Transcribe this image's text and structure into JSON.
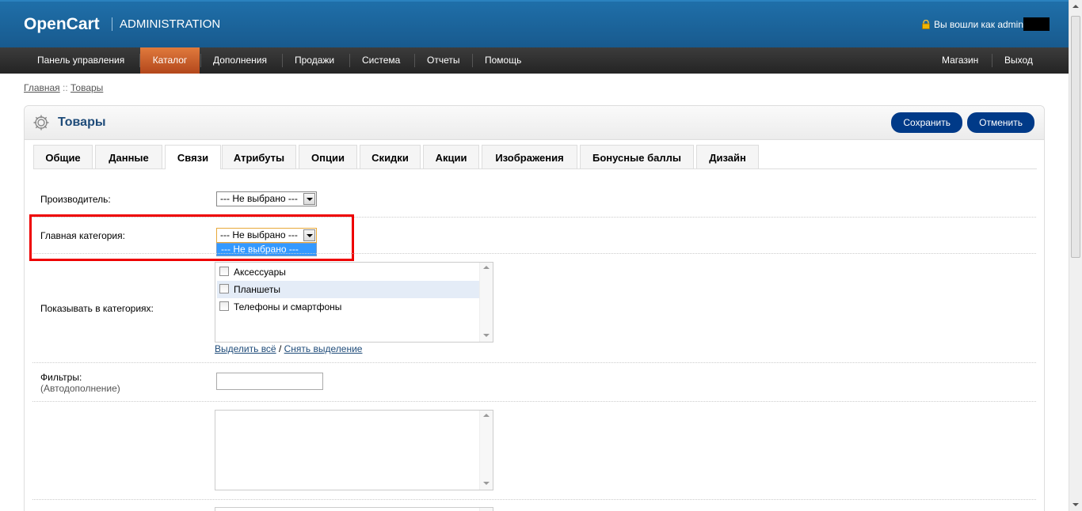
{
  "header": {
    "logo": "OpenCart",
    "subtitle": "ADMINISTRATION",
    "login_text": "Вы вошли как admin"
  },
  "menu": {
    "items": [
      {
        "label": "Панель управления"
      },
      {
        "label": "Каталог"
      },
      {
        "label": "Дополнения"
      },
      {
        "label": "Продажи"
      },
      {
        "label": "Система"
      },
      {
        "label": "Отчеты"
      },
      {
        "label": "Помощь"
      }
    ],
    "right_items": [
      {
        "label": "Магазин"
      },
      {
        "label": "Выход"
      }
    ],
    "active": "Каталог"
  },
  "breadcrumb": {
    "home": "Главная",
    "separator": " :: ",
    "current": "Товары"
  },
  "page": {
    "title": "Товары",
    "save_label": "Сохранить",
    "cancel_label": "Отменить"
  },
  "tabs": [
    {
      "label": "Общие"
    },
    {
      "label": "Данные"
    },
    {
      "label": "Связи"
    },
    {
      "label": "Атрибуты"
    },
    {
      "label": "Опции"
    },
    {
      "label": "Скидки"
    },
    {
      "label": "Акции"
    },
    {
      "label": "Изображения"
    },
    {
      "label": "Бонусные баллы"
    },
    {
      "label": "Дизайн"
    }
  ],
  "selected_tab": "Связи",
  "form": {
    "manufacturer_label": "Производитель:",
    "manufacturer_value": "--- Не выбрано ---",
    "main_category_label": "Главная категория:",
    "main_category_value": "--- Не выбрано ---",
    "main_category_options": [
      "--- Не выбрано ---"
    ],
    "categories_label": "Показывать в категориях:",
    "categories": [
      {
        "label": "Аксессуары",
        "checked": false
      },
      {
        "label": "Планшеты",
        "checked": false
      },
      {
        "label": "Телефоны и смартфоны",
        "checked": false
      }
    ],
    "select_all": "Выделить всё",
    "links_separator": " / ",
    "deselect_all": "Снять выделение",
    "filters_label": "Фильтры:",
    "filters_sub": "(Автодополнение)",
    "filters_value": ""
  },
  "colors": {
    "header_blue": "#1f6fa9",
    "menu_dark": "#2f2f2f",
    "menu_active": "#c95a26",
    "button_blue": "#003a88",
    "highlight_red": "#ee0000",
    "title_blue": "#1e4b79"
  }
}
